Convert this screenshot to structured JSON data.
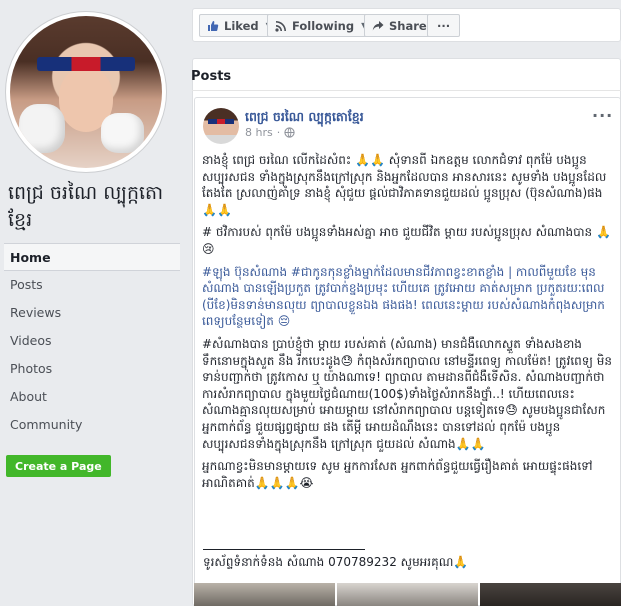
{
  "page": {
    "name": "ពេជ្រ ចរណៃ ល្បុក្កតោខ្មែរ"
  },
  "nav": {
    "items": [
      "Home",
      "Posts",
      "Reviews",
      "Videos",
      "Photos",
      "About",
      "Community"
    ],
    "active": "Home"
  },
  "create_page_label": "Create a Page",
  "actions": {
    "liked_label": "Liked",
    "following_label": "Following",
    "share_label": "Share",
    "more_label": "···"
  },
  "posts_title": "Posts",
  "post": {
    "author": "ពេជ្រ ចរណៃ ល្បុក្កតោខ្មែរ",
    "time": "8 hrs",
    "privacy_icon": "globe-icon",
    "menu_label": "···",
    "paragraphs": [
      "នាងខ្ញុំ ពេជ្រ ចរណៃ លើកដៃសំពះ 🙏🙏 សុំទានពី ឯកឧត្តម លោកជំទាវ ពុកម៉ែ បងប្អូន សប្បុរសជន ទាំងក្នុងស្រុកនឹងក្រៅស្រុក និងអ្នកដែលបាន អានសារនេះ សូមទាំង បងប្អូនដែលតែងតែ ស្រលាញ់គាំទ្រ នាងខ្ញុំ សុំជួយ ផ្ដល់ជាវិភាគទានជួយដល់ ប្អូនប្រុស (ប៊ុនសំណាង)ផង 🙏🙏",
      "# ថវិការបស់ ពុកម៉ែ បងប្អូនទាំងអស់គ្នា អាច ជួយជីវិត ម្ដាយ របស់ប្អូនប្រុស សំណាងបាន 🙏😢",
      "#ឡុង ប៊ុនសំណាង #ជាកូនកុនខ្លាំងម្នាក់ដែលមានជីវភាពខ្វះខាតខ្លាំង | កាលពីមួយខែ មុន សំណាង បានឡើងប្រកួត ត្រូវបាក់ខ្នងប្រមុះ ហើយគេ ត្រូវអោយ គាត់សម្រាក ប្រកួតរយៈពេល (បីខែ)មិនទាន់មានលុយ ព្យាបាលខ្លួនឯង ផងផង! ពេលនេះម្ដាយ របស់សំណាងកំពុងសម្រាកពេទ្យបន្ថែមទៀត 😔",
      "#សំណាងបាន ប្រាប់ខ្ញុំថា ម្ដាយ របស់គាត់ (សំណាង) មានជំងឺលោកស្ទួត ទាំងសងខាង ទឹកនោមក្នុងសួត នឹង រីកបេះដូង😓 កំពុងស័រកព្យាបាល នៅមន្ទីរពេទ្យ កាលម៉ែត! ត្រូវពេទ្យ មិនទាន់បញ្ជាក់ថា ត្រូវកោស ឬ យ៉ាងណាទេ! ព្យាបាល តាមដានពីជំងឺទើសិន. សំណាងបញ្ជាក់ថា ការសំរាកព្យាបាល ក្នុងមួយថ្ងៃជំណាយ(100$)ទាំងថ្លៃសំរាកនឹងថ្នាំ..! ហើយពេលនេះ សំណាងគ្មានលុយសម្រាប់ អោយម្ដាយ នៅសំរាកព្យាបាល បន្តទៀតទេ😓 សូមបងប្អូនជាសែក អ្នកពាក់ព័ន្ធ ជួយផ្សព្វផ្សាយ ផង តើម្ដី អោយដំណឹងនេះ បានទៅដល់ ពុកម៉ែ បងប្អូន សប្បុរសជនទាំងក្នុងស្រុកនឹង ក្រៅស្រុក ជួយដល់ សំណាង🙏🙏",
      "អ្នកណាខ្វះមិនមានម្ដាយទេ សូម អ្នកការសែត អ្នកពាក់ព័ន្ធជួយធ្វើរឿងគាត់ អោយផ្ទុះផងទៅ អាណិតគាត់🙏🙏🙏😭"
    ],
    "contact": "ទូរស័ព្ទទំនាក់ទំនង សំណាង 070789232 សូមអរគុណ🙏"
  },
  "colors": {
    "link": "#385898",
    "green": "#42b72a",
    "bg": "#e9ebee",
    "flag_blue": "#17307a",
    "flag_red": "#c81b2a"
  }
}
